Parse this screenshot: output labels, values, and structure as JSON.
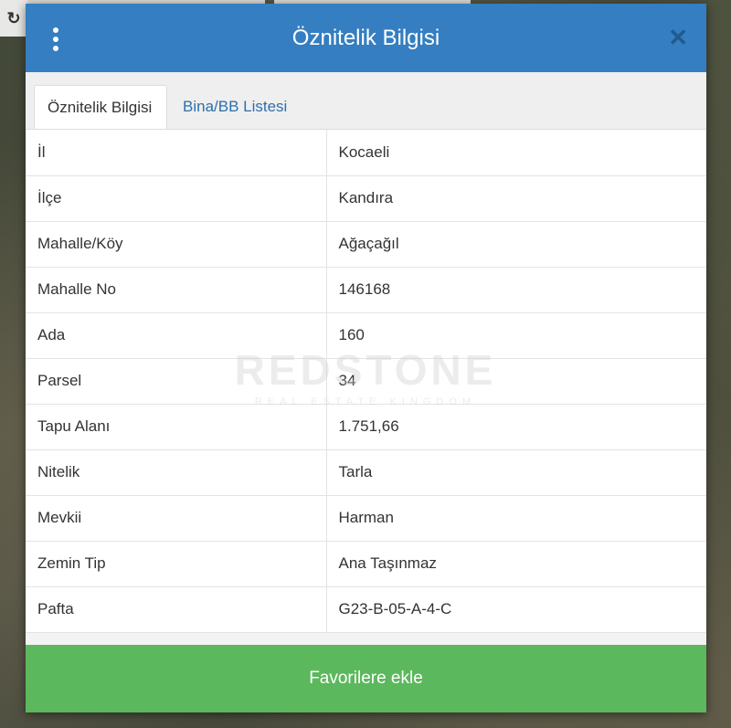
{
  "dialog": {
    "title": "Öznitelik Bilgisi"
  },
  "tabs": [
    {
      "label": "Öznitelik Bilgisi",
      "active": true
    },
    {
      "label": "Bina/BB Listesi",
      "active": false
    }
  ],
  "attributes": [
    {
      "key": "İl",
      "value": "Kocaeli"
    },
    {
      "key": "İlçe",
      "value": "Kandıra"
    },
    {
      "key": "Mahalle/Köy",
      "value": "Ağaçağıl"
    },
    {
      "key": "Mahalle No",
      "value": "146168"
    },
    {
      "key": "Ada",
      "value": "160"
    },
    {
      "key": "Parsel",
      "value": "34"
    },
    {
      "key": "Tapu Alanı",
      "value": "1.751,66"
    },
    {
      "key": "Nitelik",
      "value": "Tarla"
    },
    {
      "key": "Mevkii",
      "value": "Harman"
    },
    {
      "key": "Zemin Tip",
      "value": "Ana Taşınmaz"
    },
    {
      "key": "Pafta",
      "value": "G23-B-05-A-4-C"
    }
  ],
  "footer": {
    "button_label": "Favorilere ekle"
  },
  "watermark": {
    "brand": "REDSTONE",
    "tagline": "REAL ESTATE KINGDOM"
  },
  "colors": {
    "header": "#347ec1",
    "button": "#5cb85c",
    "tab_link": "#2e6fad"
  }
}
